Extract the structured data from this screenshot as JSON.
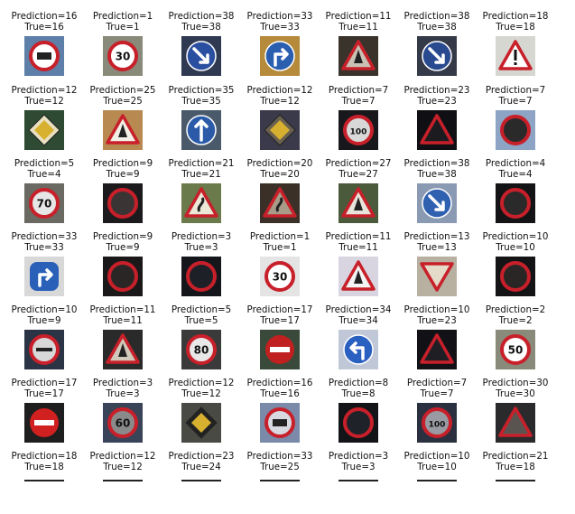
{
  "figure": {
    "caption_prefix_prediction": "Prediction=",
    "caption_prefix_true": "True=",
    "samples": [
      {
        "prediction": 16,
        "true": 16,
        "icon": "no-trucks-sign-icon",
        "bg": "#5e7fa8",
        "type": "round-red",
        "fill": "#ffffff",
        "sym": "truck"
      },
      {
        "prediction": 1,
        "true": 1,
        "icon": "speed-limit-30-sign-icon",
        "bg": "#8a8a7a",
        "type": "round-red",
        "fill": "#ffffff",
        "sym": "30"
      },
      {
        "prediction": 38,
        "true": 38,
        "icon": "keep-right-sign-icon",
        "bg": "#2f3a52",
        "type": "blue-circle",
        "fill": "#2a4fa0",
        "sym": "arrow-dr"
      },
      {
        "prediction": 33,
        "true": 33,
        "icon": "turn-right-ahead-sign-icon",
        "bg": "#b58a3a",
        "type": "blue-circle",
        "fill": "#2a5fb0",
        "sym": "arrow-r"
      },
      {
        "prediction": 11,
        "true": 11,
        "icon": "right-of-way-sign-icon",
        "bg": "#3a332c",
        "type": "triangle",
        "fill": "#c9c2b4",
        "sym": "mark"
      },
      {
        "prediction": 38,
        "true": 38,
        "icon": "keep-right-sign-icon",
        "bg": "#343a48",
        "type": "blue-circle",
        "fill": "#2a4a90",
        "sym": "arrow-dr"
      },
      {
        "prediction": 18,
        "true": 18,
        "icon": "general-caution-sign-icon",
        "bg": "#d7d7d2",
        "type": "triangle",
        "fill": "#ffffff",
        "sym": "excl"
      },
      {
        "prediction": 12,
        "true": 12,
        "icon": "priority-road-sign-icon",
        "bg": "#2e4a32",
        "type": "diamond",
        "fill": "#e8e0c0",
        "sym": ""
      },
      {
        "prediction": 25,
        "true": 25,
        "icon": "road-work-sign-icon",
        "bg": "#b88a52",
        "type": "triangle",
        "fill": "#f2efe6",
        "sym": "mark"
      },
      {
        "prediction": 35,
        "true": 35,
        "icon": "ahead-only-sign-icon",
        "bg": "#4a5a6a",
        "type": "blue-circle",
        "fill": "#2a5aa8",
        "sym": "arrow-u"
      },
      {
        "prediction": 12,
        "true": 12,
        "icon": "priority-road-sign-icon",
        "bg": "#3a3a4a",
        "type": "diamond",
        "fill": "#6a6050",
        "sym": ""
      },
      {
        "prediction": 7,
        "true": 7,
        "icon": "speed-limit-100-sign-icon",
        "bg": "#18181c",
        "type": "round-red",
        "fill": "#d8d8d8",
        "sym": "100"
      },
      {
        "prediction": 23,
        "true": 23,
        "icon": "slippery-road-sign-icon",
        "bg": "#101014",
        "type": "triangle",
        "fill": "#1c1c20",
        "sym": ""
      },
      {
        "prediction": 7,
        "true": 7,
        "icon": "speed-limit-100-sign-icon",
        "bg": "#8ea4c4",
        "type": "round-red",
        "fill": "#2a2a2a",
        "sym": ""
      },
      {
        "prediction": 5,
        "true": 4,
        "icon": "speed-limit-70-sign-icon",
        "bg": "#6a6a62",
        "type": "round-red",
        "fill": "#e6e6e6",
        "sym": "70"
      },
      {
        "prediction": 9,
        "true": 9,
        "icon": "no-passing-sign-icon",
        "bg": "#1c1a1c",
        "type": "round-red",
        "fill": "#3a3434",
        "sym": ""
      },
      {
        "prediction": 21,
        "true": 21,
        "icon": "double-curve-sign-icon",
        "bg": "#6a7a4a",
        "type": "triangle",
        "fill": "#ece8d8",
        "sym": "curve"
      },
      {
        "prediction": 20,
        "true": 20,
        "icon": "dangerous-curve-right-sign-icon",
        "bg": "#3a3028",
        "type": "triangle",
        "fill": "#a89c88",
        "sym": "curve"
      },
      {
        "prediction": 27,
        "true": 27,
        "icon": "pedestrians-sign-icon",
        "bg": "#4a5a3a",
        "type": "triangle",
        "fill": "#e8e4dc",
        "sym": "mark"
      },
      {
        "prediction": 38,
        "true": 38,
        "icon": "keep-right-sign-icon",
        "bg": "#8a9ab2",
        "type": "blue-circle",
        "fill": "#3060b0",
        "sym": "arrow-dr"
      },
      {
        "prediction": 4,
        "true": 4,
        "icon": "speed-limit-70-sign-icon",
        "bg": "#141416",
        "type": "round-red",
        "fill": "#2a2a2a",
        "sym": ""
      },
      {
        "prediction": 33,
        "true": 33,
        "icon": "turn-right-ahead-sign-icon",
        "bg": "#d8d8d8",
        "type": "blue-square",
        "fill": "#2a60b8",
        "sym": "arrow-r"
      },
      {
        "prediction": 9,
        "true": 9,
        "icon": "no-passing-sign-icon",
        "bg": "#1a1818",
        "type": "round-red",
        "fill": "#2a2626",
        "sym": ""
      },
      {
        "prediction": 3,
        "true": 3,
        "icon": "speed-limit-60-sign-icon",
        "bg": "#14161c",
        "type": "round-red",
        "fill": "#1e2028",
        "sym": ""
      },
      {
        "prediction": 1,
        "true": 1,
        "icon": "speed-limit-30-sign-icon",
        "bg": "#e4e4e4",
        "type": "round-red",
        "fill": "#ffffff",
        "sym": "30"
      },
      {
        "prediction": 11,
        "true": 11,
        "icon": "right-of-way-sign-icon",
        "bg": "#d8d4e0",
        "type": "triangle",
        "fill": "#f4f4f4",
        "sym": "mark"
      },
      {
        "prediction": 13,
        "true": 13,
        "icon": "yield-sign-icon",
        "bg": "#b8b0a0",
        "type": "triangle-down",
        "fill": "#e4dcc8",
        "sym": ""
      },
      {
        "prediction": 10,
        "true": 10,
        "icon": "no-passing-trucks-sign-icon",
        "bg": "#141416",
        "type": "round-red",
        "fill": "#2a2626",
        "sym": ""
      },
      {
        "prediction": 10,
        "true": 9,
        "icon": "no-passing-sign-icon",
        "bg": "#2a3444",
        "type": "round-red",
        "fill": "#d8d8d8",
        "sym": "bar"
      },
      {
        "prediction": 11,
        "true": 11,
        "icon": "right-of-way-sign-icon",
        "bg": "#2a2a2a",
        "type": "triangle",
        "fill": "#d0c8b8",
        "sym": "mark"
      },
      {
        "prediction": 5,
        "true": 5,
        "icon": "speed-limit-80-sign-icon",
        "bg": "#3a3a3a",
        "type": "round-red",
        "fill": "#e8e8e8",
        "sym": "80"
      },
      {
        "prediction": 17,
        "true": 17,
        "icon": "no-entry-sign-icon",
        "bg": "#3a4a3a",
        "type": "no-entry",
        "fill": "#c02020",
        "sym": ""
      },
      {
        "prediction": 34,
        "true": 34,
        "icon": "turn-left-ahead-sign-icon",
        "bg": "#c0c8d8",
        "type": "blue-circle",
        "fill": "#2a60c0",
        "sym": "arrow-l"
      },
      {
        "prediction": 10,
        "true": 23,
        "icon": "slippery-road-sign-icon",
        "bg": "#121216",
        "type": "triangle",
        "fill": "#1e1e24",
        "sym": ""
      },
      {
        "prediction": 2,
        "true": 2,
        "icon": "speed-limit-50-sign-icon",
        "bg": "#8a8a7a",
        "type": "round-red",
        "fill": "#ffffff",
        "sym": "50"
      },
      {
        "prediction": 17,
        "true": 17,
        "icon": "no-entry-sign-icon",
        "bg": "#1e1e1e",
        "type": "no-entry",
        "fill": "#d02020",
        "sym": ""
      },
      {
        "prediction": 3,
        "true": 3,
        "icon": "speed-limit-60-sign-icon",
        "bg": "#3a4458",
        "type": "round-red",
        "fill": "#8a8a8a",
        "sym": "60"
      },
      {
        "prediction": 12,
        "true": 12,
        "icon": "priority-road-sign-icon",
        "bg": "#4a4a44",
        "type": "diamond",
        "fill": "#222222",
        "sym": ""
      },
      {
        "prediction": 16,
        "true": 16,
        "icon": "no-trucks-sign-icon",
        "bg": "#7a8aa8",
        "type": "round-red",
        "fill": "#d8d8e0",
        "sym": "truck"
      },
      {
        "prediction": 8,
        "true": 8,
        "icon": "speed-limit-120-sign-icon",
        "bg": "#121418",
        "type": "round-red",
        "fill": "#20222a",
        "sym": ""
      },
      {
        "prediction": 7,
        "true": 7,
        "icon": "speed-limit-100-sign-icon",
        "bg": "#2a3040",
        "type": "round-red",
        "fill": "#9a9aa2",
        "sym": "100"
      },
      {
        "prediction": 30,
        "true": 30,
        "icon": "beware-ice-snow-sign-icon",
        "bg": "#2a2a2c",
        "type": "triangle",
        "fill": "#5a5450",
        "sym": ""
      },
      {
        "prediction": 18,
        "true": 18,
        "icon": "general-caution-sign-icon",
        "bg": "#ffffff",
        "type": "strip",
        "fill": "#222222",
        "sym": ""
      },
      {
        "prediction": 12,
        "true": 12,
        "icon": "priority-road-sign-icon",
        "bg": "#ffffff",
        "type": "strip",
        "fill": "#222222",
        "sym": ""
      },
      {
        "prediction": 23,
        "true": 24,
        "icon": "road-narrows-sign-icon",
        "bg": "#ffffff",
        "type": "strip",
        "fill": "#222222",
        "sym": ""
      },
      {
        "prediction": 33,
        "true": 25,
        "icon": "road-work-sign-icon",
        "bg": "#ffffff",
        "type": "strip",
        "fill": "#222222",
        "sym": ""
      },
      {
        "prediction": 3,
        "true": 3,
        "icon": "speed-limit-60-sign-icon",
        "bg": "#ffffff",
        "type": "strip",
        "fill": "#222222",
        "sym": ""
      },
      {
        "prediction": 10,
        "true": 10,
        "icon": "no-passing-trucks-sign-icon",
        "bg": "#ffffff",
        "type": "strip",
        "fill": "#222222",
        "sym": ""
      },
      {
        "prediction": 21,
        "true": 18,
        "icon": "general-caution-sign-icon",
        "bg": "#ffffff",
        "type": "strip",
        "fill": "#222222",
        "sym": ""
      }
    ]
  }
}
